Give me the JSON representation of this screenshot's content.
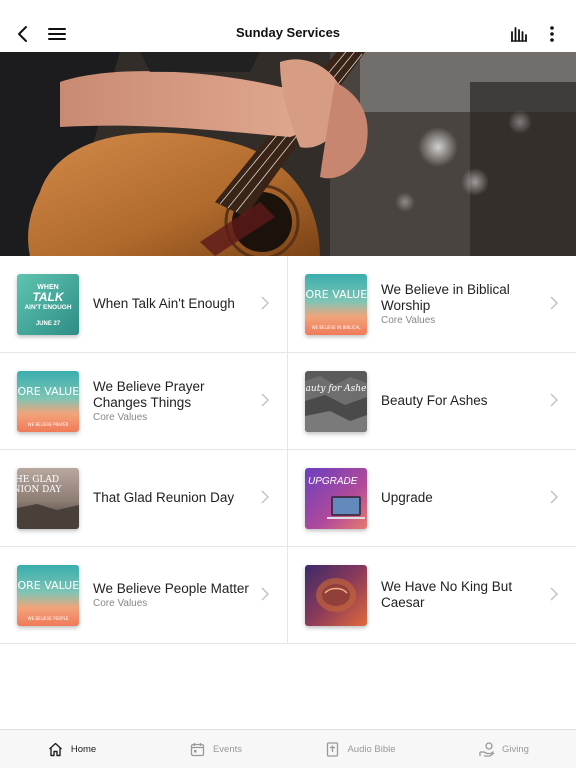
{
  "nav": {
    "title": "Sunday Services"
  },
  "items": [
    {
      "title": "When Talk Ain't Enough",
      "subtitle": "",
      "thumb": {
        "kind": "when-talk",
        "lines": [
          "WHEN",
          "TALK",
          "AIN'T ENOUGH"
        ],
        "date": "JUNE 27"
      }
    },
    {
      "title": "We Believe in Biblical Worship",
      "subtitle": "Core Values",
      "thumb": {
        "kind": "core-values",
        "big": "CORE VALUES",
        "small": "WE BELIEVE IN BIBLICAL"
      }
    },
    {
      "title": "We Believe Prayer Changes Things",
      "subtitle": "Core Values",
      "thumb": {
        "kind": "core-values",
        "big": "CORE VALUES",
        "small": "WE BELIEVE PRAYER"
      }
    },
    {
      "title": "Beauty For Ashes",
      "subtitle": "",
      "thumb": {
        "kind": "ashes",
        "script": "auty for Ashe"
      }
    },
    {
      "title": "That Glad Reunion Day",
      "subtitle": "",
      "thumb": {
        "kind": "reunion",
        "lines": [
          "HE GLAD",
          "NION DAY"
        ]
      }
    },
    {
      "title": "Upgrade",
      "subtitle": "",
      "thumb": {
        "kind": "upgrade",
        "label": "UPGRADE"
      }
    },
    {
      "title": "We Believe People Matter",
      "subtitle": "Core Values",
      "thumb": {
        "kind": "core-values",
        "big": "CORE VALUES",
        "small": "WE BELIEVE PEOPLE"
      }
    },
    {
      "title": "We Have No King But Caesar",
      "subtitle": "",
      "thumb": {
        "kind": "king",
        "label": ""
      }
    }
  ],
  "tabs": [
    {
      "label": "Home",
      "icon": "home-icon",
      "active": true
    },
    {
      "label": "Events",
      "icon": "calendar-icon",
      "active": false
    },
    {
      "label": "Audio Bible",
      "icon": "bible-icon",
      "active": false
    },
    {
      "label": "Giving",
      "icon": "giving-icon",
      "active": false
    }
  ],
  "colors": {
    "active": "#222222",
    "inactive": "#999999",
    "divider": "#e6e6e6"
  }
}
